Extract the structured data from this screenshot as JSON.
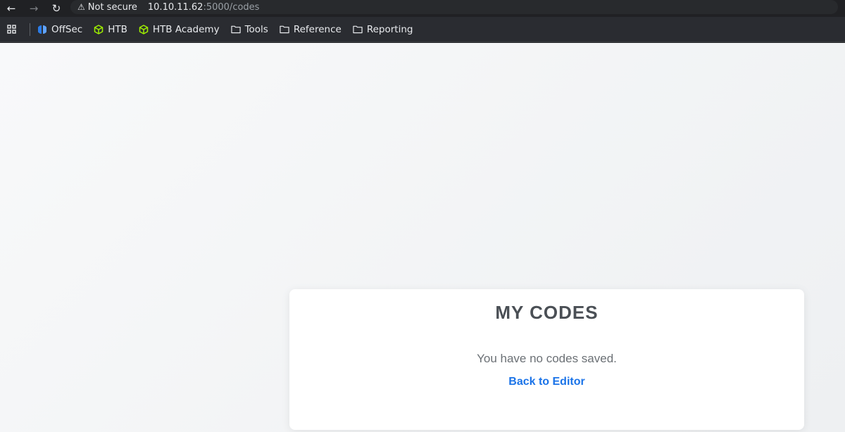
{
  "browser": {
    "security_label": "Not secure",
    "url_host": "10.10.11.62",
    "url_path": ":5000/codes",
    "bookmarks": [
      {
        "label": "OffSec",
        "icon": "offsec-icon"
      },
      {
        "label": "HTB",
        "icon": "htb-cube-icon"
      },
      {
        "label": "HTB Academy",
        "icon": "htb-cube-icon"
      },
      {
        "label": "Tools",
        "icon": "folder-icon"
      },
      {
        "label": "Reference",
        "icon": "folder-icon"
      },
      {
        "label": "Reporting",
        "icon": "folder-icon"
      }
    ],
    "colors": {
      "htb_green": "#9fef00",
      "offsec_blue": "#2b7de9"
    }
  },
  "page": {
    "title": "MY CODES",
    "empty_message": "You have no codes saved.",
    "back_link": "Back to Editor"
  }
}
